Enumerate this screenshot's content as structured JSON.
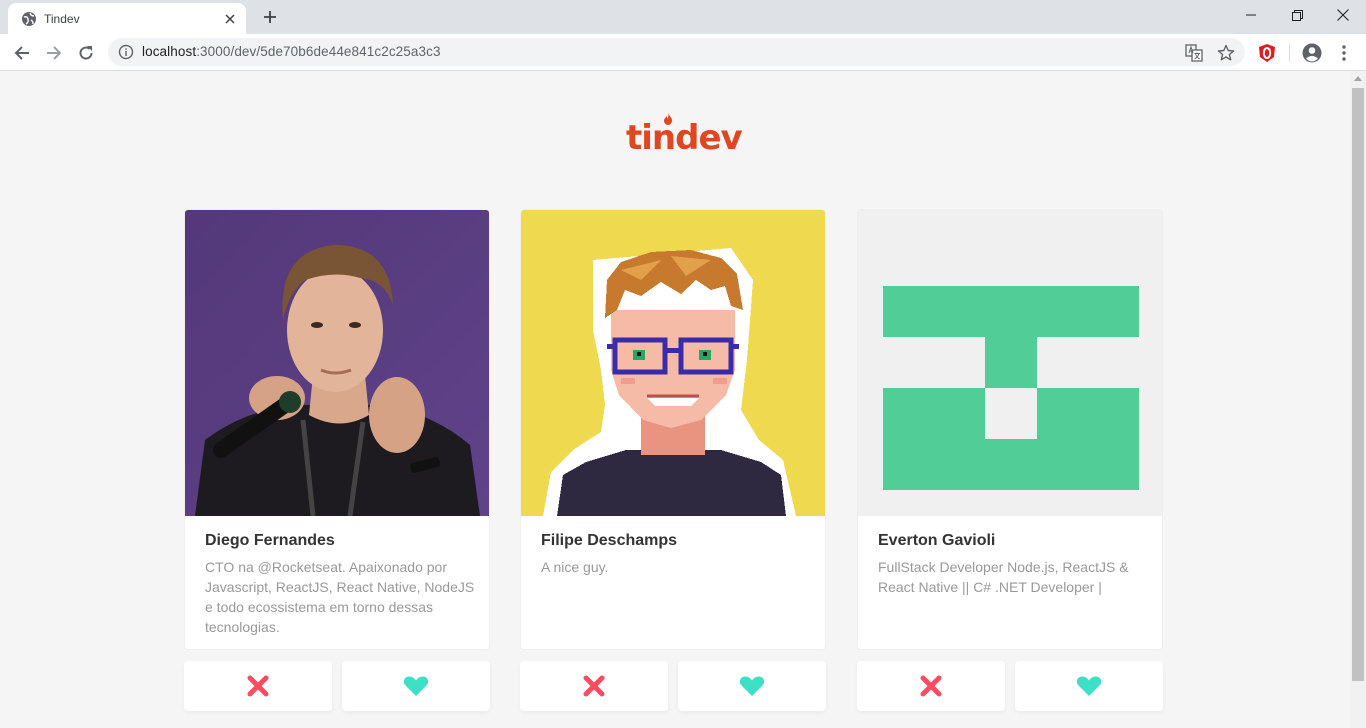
{
  "browser": {
    "tab_title": "Tindev",
    "url_host": "localhost",
    "url_rest": ":3000/dev/5de70b6de44e841c2c25a3c3"
  },
  "page": {
    "logo_text": "tindev",
    "colors": {
      "brand": "#df4723",
      "dislike": "#ff4b5f",
      "like": "#3ddfc5"
    },
    "users": [
      {
        "name": "Diego Fernandes",
        "bio": "CTO na @Rocketseat. Apaixonado por Javascript, ReactJS, React Native, NodeJS e todo ecossistema em torno dessas tecnologias."
      },
      {
        "name": "Filipe Deschamps",
        "bio": "A nice guy."
      },
      {
        "name": "Everton Gavioli",
        "bio": "FullStack Developer Node.js, ReactJS & React Native || C# .NET Developer |"
      }
    ]
  }
}
